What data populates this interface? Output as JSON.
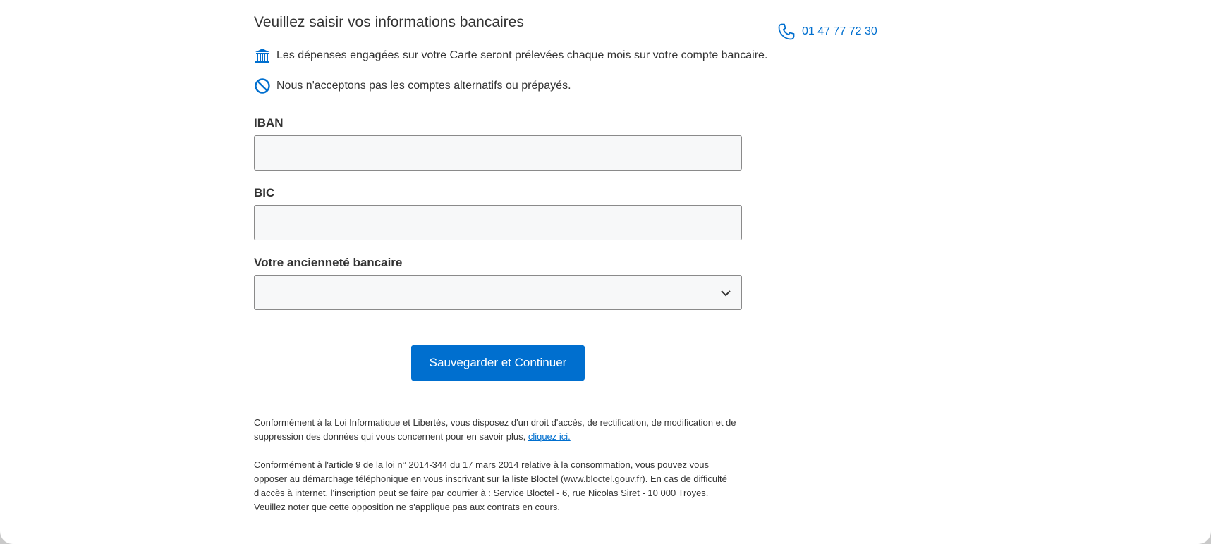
{
  "colors": {
    "accent": "#006fcf",
    "text": "#333333",
    "field_bg": "#f7f8f9",
    "field_border": "#8a8a8a"
  },
  "header": {
    "title": "Veuillez saisir vos informations bancaires"
  },
  "info": [
    {
      "icon": "bank-icon",
      "text": "Les dépenses engagées sur votre Carte seront prélevées chaque mois sur votre compte bancaire."
    },
    {
      "icon": "prohibited-icon",
      "text": "Nous n'acceptons pas les comptes alternatifs ou prépayés."
    }
  ],
  "form": {
    "iban_label": "IBAN",
    "iban_value": "",
    "bic_label": "BIC",
    "bic_value": "",
    "anciennete_label": "Votre ancienneté bancaire",
    "anciennete_value": "",
    "submit_label": "Sauvegarder et Continuer"
  },
  "legal": {
    "paragraph1_text": "Conformément à la Loi Informatique et Libertés, vous disposez d'un droit d'accès, de rectification, de modification et de suppression des données qui vous concernent pour en savoir plus, ",
    "paragraph1_link": "cliquez ici.",
    "paragraph2": "Conformément à l'article 9 de la loi n° 2014-344 du 17 mars 2014 relative à la consommation, vous pouvez vous opposer au démarchage téléphonique en vous inscrivant sur la liste Bloctel (www.bloctel.gouv.fr). En cas de difficulté d'accès à internet, l'inscription peut se faire par courrier à : Service Bloctel - 6, rue Nicolas Siret - 10 000 Troyes. Veuillez noter que cette opposition ne s'applique pas aux contrats en cours."
  },
  "contact": {
    "icon": "phone-icon",
    "phone": "01 47 77 72 30"
  }
}
